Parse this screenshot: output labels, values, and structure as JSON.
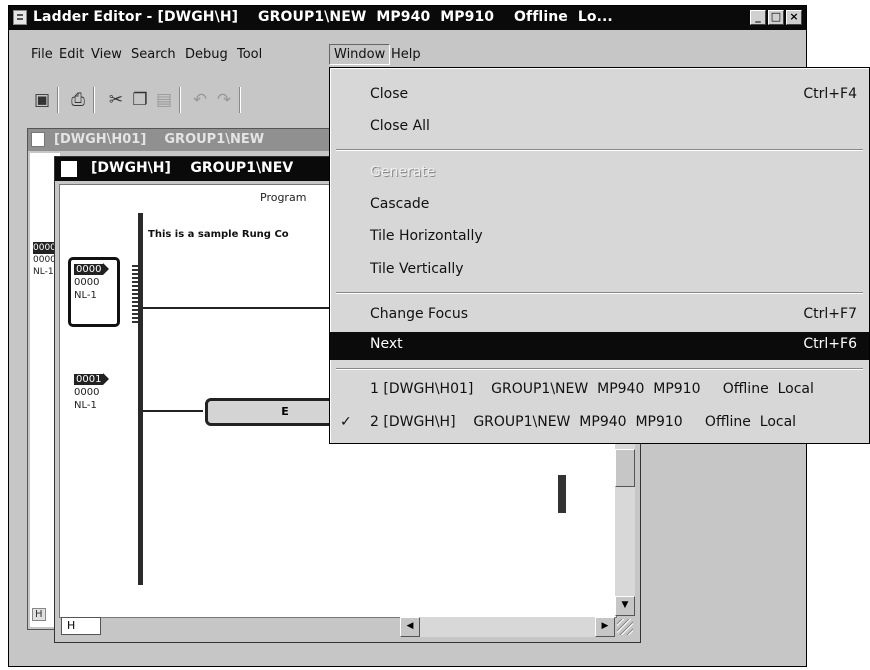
{
  "app": {
    "title": "Ladder Editor - [DWGH\\H]    GROUP1\\NEW  MP940  MP910    Offline  Lo..."
  },
  "window_buttons": {
    "minimize": "_",
    "maximize": "□",
    "close": "×"
  },
  "menubar": {
    "items": [
      "File",
      "Edit",
      "View",
      "Search",
      "Debug",
      "Tool",
      "Window",
      "Help"
    ]
  },
  "toolbar": {
    "icons": [
      "save-icon",
      "print-icon",
      "cut-icon",
      "copy-icon",
      "paste-icon",
      "undo-icon",
      "redo-icon"
    ]
  },
  "child_back": {
    "title": "[DWGH\\H01]    GROUP1\\NEW",
    "codes": [
      "0000",
      "0000",
      "NL-1"
    ],
    "sheet_tab": "H"
  },
  "child_front": {
    "title": "[DWGH\\H]    GROUP1\\NEV",
    "program_label": "Program",
    "rung_comment": "This is a sample Rung Co",
    "rung1": {
      "code": "0000",
      "line2": "0000",
      "line3": "NL-1"
    },
    "rung2": {
      "code": "0001",
      "line2": "0000",
      "line3": "NL-1"
    },
    "end_label": "E",
    "sheet_tab": "H"
  },
  "window_menu": {
    "items": [
      {
        "label": "Close",
        "shortcut": "Ctrl+F4"
      },
      {
        "label": "Close All",
        "shortcut": ""
      },
      {
        "label": "Generate",
        "shortcut": "",
        "disabled": true
      },
      {
        "label": "Cascade",
        "shortcut": ""
      },
      {
        "label": "Tile Horizontally",
        "shortcut": ""
      },
      {
        "label": "Tile Vertically",
        "shortcut": ""
      },
      {
        "label": "Change Focus",
        "shortcut": "Ctrl+F7"
      },
      {
        "label": "Next",
        "shortcut": "Ctrl+F6",
        "highlighted": true
      },
      {
        "label": "1 [DWGH\\H01]    GROUP1\\NEW  MP940  MP910     Offline  Local",
        "shortcut": ""
      },
      {
        "label": "2 [DWGH\\H]    GROUP1\\NEW  MP940  MP910     Offline  Local",
        "shortcut": "",
        "checked": true
      }
    ],
    "check_mark": "✓"
  }
}
